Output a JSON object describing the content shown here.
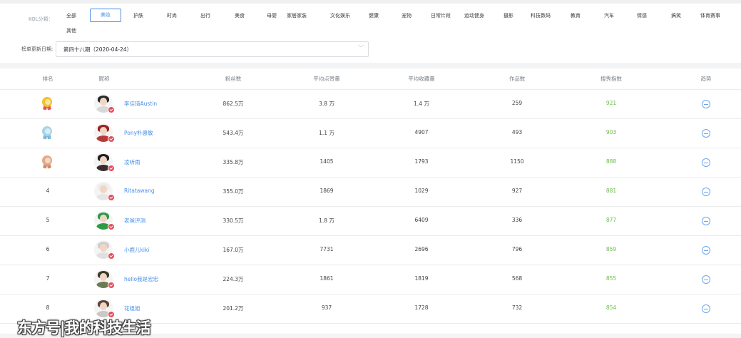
{
  "filters": {
    "kol_label": "KOL分類：",
    "categories": [
      "全部",
      "美妆",
      "护肤",
      "时尚",
      "出行",
      "美食",
      "母婴",
      "家居家装",
      "文化娱乐",
      "健康",
      "宠物",
      "日常片段",
      "运动健身",
      "摄影",
      "科技数码",
      "教育",
      "汽车",
      "情感",
      "搞笑",
      "体育赛事",
      "其他"
    ],
    "active": "美妆",
    "date_label": "榜单更新日期:",
    "date_value": "第四十八期（2020-04-24）"
  },
  "table": {
    "headers": [
      "排名",
      "昵称",
      "粉丝数",
      "平均点赞量",
      "平均收藏量",
      "作品数",
      "搜秀指数",
      "趋势"
    ],
    "rows": [
      {
        "rank": "1",
        "medal": "gold",
        "nickname": "李佳琦Austin",
        "fans": "862.5万",
        "avg_likes": "3.8 万",
        "avg_favs": "1.4 万",
        "works": "259",
        "index": "921"
      },
      {
        "rank": "2",
        "medal": "silver",
        "nickname": "Pony朴惠敏",
        "fans": "543.4万",
        "avg_likes": "1.1 万",
        "avg_favs": "4907",
        "works": "493",
        "index": "903"
      },
      {
        "rank": "3",
        "medal": "bronze",
        "nickname": "凌听雨",
        "fans": "335.8万",
        "avg_likes": "1405",
        "avg_favs": "1793",
        "works": "1150",
        "index": "888"
      },
      {
        "rank": "4",
        "medal": "",
        "nickname": "Ritatawang",
        "fans": "355.0万",
        "avg_likes": "1869",
        "avg_favs": "1029",
        "works": "927",
        "index": "881"
      },
      {
        "rank": "5",
        "medal": "",
        "nickname": "老爸评测",
        "fans": "330.5万",
        "avg_likes": "1.8 万",
        "avg_favs": "6409",
        "works": "336",
        "index": "877"
      },
      {
        "rank": "6",
        "medal": "",
        "nickname": "小鹿儿kiki",
        "fans": "167.0万",
        "avg_likes": "7731",
        "avg_favs": "2696",
        "works": "796",
        "index": "859"
      },
      {
        "rank": "7",
        "medal": "",
        "nickname": "hello我是宏宏",
        "fans": "224.3万",
        "avg_likes": "1861",
        "avg_favs": "1819",
        "works": "568",
        "index": "855"
      },
      {
        "rank": "8",
        "medal": "",
        "nickname": "花姐姐",
        "fans": "201.2万",
        "avg_likes": "937",
        "avg_favs": "1728",
        "works": "732",
        "index": "854"
      }
    ]
  },
  "colors": {
    "accent": "#4a8fe7",
    "score": "#6cbe4a",
    "gold": "#f2c12e",
    "silver": "#a8d4e8",
    "bronze": "#e5a886"
  },
  "watermark": "东方号|我的科技生活"
}
